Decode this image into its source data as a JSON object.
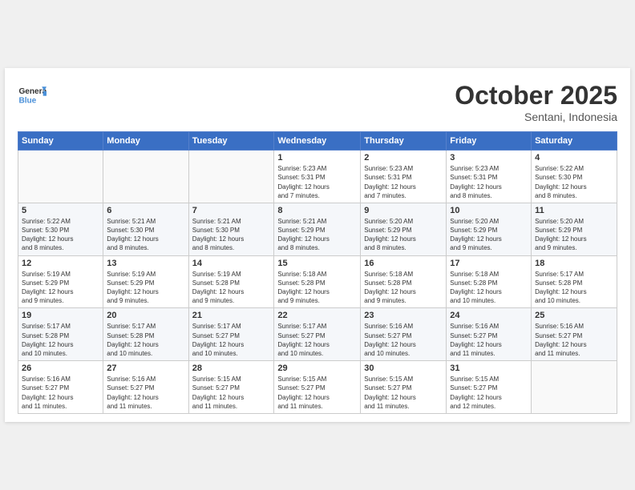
{
  "header": {
    "logo_line1": "General",
    "logo_line2": "Blue",
    "month": "October 2025",
    "location": "Sentani, Indonesia"
  },
  "weekdays": [
    "Sunday",
    "Monday",
    "Tuesday",
    "Wednesday",
    "Thursday",
    "Friday",
    "Saturday"
  ],
  "weeks": [
    [
      {
        "day": "",
        "info": ""
      },
      {
        "day": "",
        "info": ""
      },
      {
        "day": "",
        "info": ""
      },
      {
        "day": "1",
        "info": "Sunrise: 5:23 AM\nSunset: 5:31 PM\nDaylight: 12 hours\nand 7 minutes."
      },
      {
        "day": "2",
        "info": "Sunrise: 5:23 AM\nSunset: 5:31 PM\nDaylight: 12 hours\nand 7 minutes."
      },
      {
        "day": "3",
        "info": "Sunrise: 5:23 AM\nSunset: 5:31 PM\nDaylight: 12 hours\nand 8 minutes."
      },
      {
        "day": "4",
        "info": "Sunrise: 5:22 AM\nSunset: 5:30 PM\nDaylight: 12 hours\nand 8 minutes."
      }
    ],
    [
      {
        "day": "5",
        "info": "Sunrise: 5:22 AM\nSunset: 5:30 PM\nDaylight: 12 hours\nand 8 minutes."
      },
      {
        "day": "6",
        "info": "Sunrise: 5:21 AM\nSunset: 5:30 PM\nDaylight: 12 hours\nand 8 minutes."
      },
      {
        "day": "7",
        "info": "Sunrise: 5:21 AM\nSunset: 5:30 PM\nDaylight: 12 hours\nand 8 minutes."
      },
      {
        "day": "8",
        "info": "Sunrise: 5:21 AM\nSunset: 5:29 PM\nDaylight: 12 hours\nand 8 minutes."
      },
      {
        "day": "9",
        "info": "Sunrise: 5:20 AM\nSunset: 5:29 PM\nDaylight: 12 hours\nand 8 minutes."
      },
      {
        "day": "10",
        "info": "Sunrise: 5:20 AM\nSunset: 5:29 PM\nDaylight: 12 hours\nand 9 minutes."
      },
      {
        "day": "11",
        "info": "Sunrise: 5:20 AM\nSunset: 5:29 PM\nDaylight: 12 hours\nand 9 minutes."
      }
    ],
    [
      {
        "day": "12",
        "info": "Sunrise: 5:19 AM\nSunset: 5:29 PM\nDaylight: 12 hours\nand 9 minutes."
      },
      {
        "day": "13",
        "info": "Sunrise: 5:19 AM\nSunset: 5:29 PM\nDaylight: 12 hours\nand 9 minutes."
      },
      {
        "day": "14",
        "info": "Sunrise: 5:19 AM\nSunset: 5:28 PM\nDaylight: 12 hours\nand 9 minutes."
      },
      {
        "day": "15",
        "info": "Sunrise: 5:18 AM\nSunset: 5:28 PM\nDaylight: 12 hours\nand 9 minutes."
      },
      {
        "day": "16",
        "info": "Sunrise: 5:18 AM\nSunset: 5:28 PM\nDaylight: 12 hours\nand 9 minutes."
      },
      {
        "day": "17",
        "info": "Sunrise: 5:18 AM\nSunset: 5:28 PM\nDaylight: 12 hours\nand 10 minutes."
      },
      {
        "day": "18",
        "info": "Sunrise: 5:17 AM\nSunset: 5:28 PM\nDaylight: 12 hours\nand 10 minutes."
      }
    ],
    [
      {
        "day": "19",
        "info": "Sunrise: 5:17 AM\nSunset: 5:28 PM\nDaylight: 12 hours\nand 10 minutes."
      },
      {
        "day": "20",
        "info": "Sunrise: 5:17 AM\nSunset: 5:28 PM\nDaylight: 12 hours\nand 10 minutes."
      },
      {
        "day": "21",
        "info": "Sunrise: 5:17 AM\nSunset: 5:27 PM\nDaylight: 12 hours\nand 10 minutes."
      },
      {
        "day": "22",
        "info": "Sunrise: 5:17 AM\nSunset: 5:27 PM\nDaylight: 12 hours\nand 10 minutes."
      },
      {
        "day": "23",
        "info": "Sunrise: 5:16 AM\nSunset: 5:27 PM\nDaylight: 12 hours\nand 10 minutes."
      },
      {
        "day": "24",
        "info": "Sunrise: 5:16 AM\nSunset: 5:27 PM\nDaylight: 12 hours\nand 11 minutes."
      },
      {
        "day": "25",
        "info": "Sunrise: 5:16 AM\nSunset: 5:27 PM\nDaylight: 12 hours\nand 11 minutes."
      }
    ],
    [
      {
        "day": "26",
        "info": "Sunrise: 5:16 AM\nSunset: 5:27 PM\nDaylight: 12 hours\nand 11 minutes."
      },
      {
        "day": "27",
        "info": "Sunrise: 5:16 AM\nSunset: 5:27 PM\nDaylight: 12 hours\nand 11 minutes."
      },
      {
        "day": "28",
        "info": "Sunrise: 5:15 AM\nSunset: 5:27 PM\nDaylight: 12 hours\nand 11 minutes."
      },
      {
        "day": "29",
        "info": "Sunrise: 5:15 AM\nSunset: 5:27 PM\nDaylight: 12 hours\nand 11 minutes."
      },
      {
        "day": "30",
        "info": "Sunrise: 5:15 AM\nSunset: 5:27 PM\nDaylight: 12 hours\nand 11 minutes."
      },
      {
        "day": "31",
        "info": "Sunrise: 5:15 AM\nSunset: 5:27 PM\nDaylight: 12 hours\nand 12 minutes."
      },
      {
        "day": "",
        "info": ""
      }
    ]
  ]
}
